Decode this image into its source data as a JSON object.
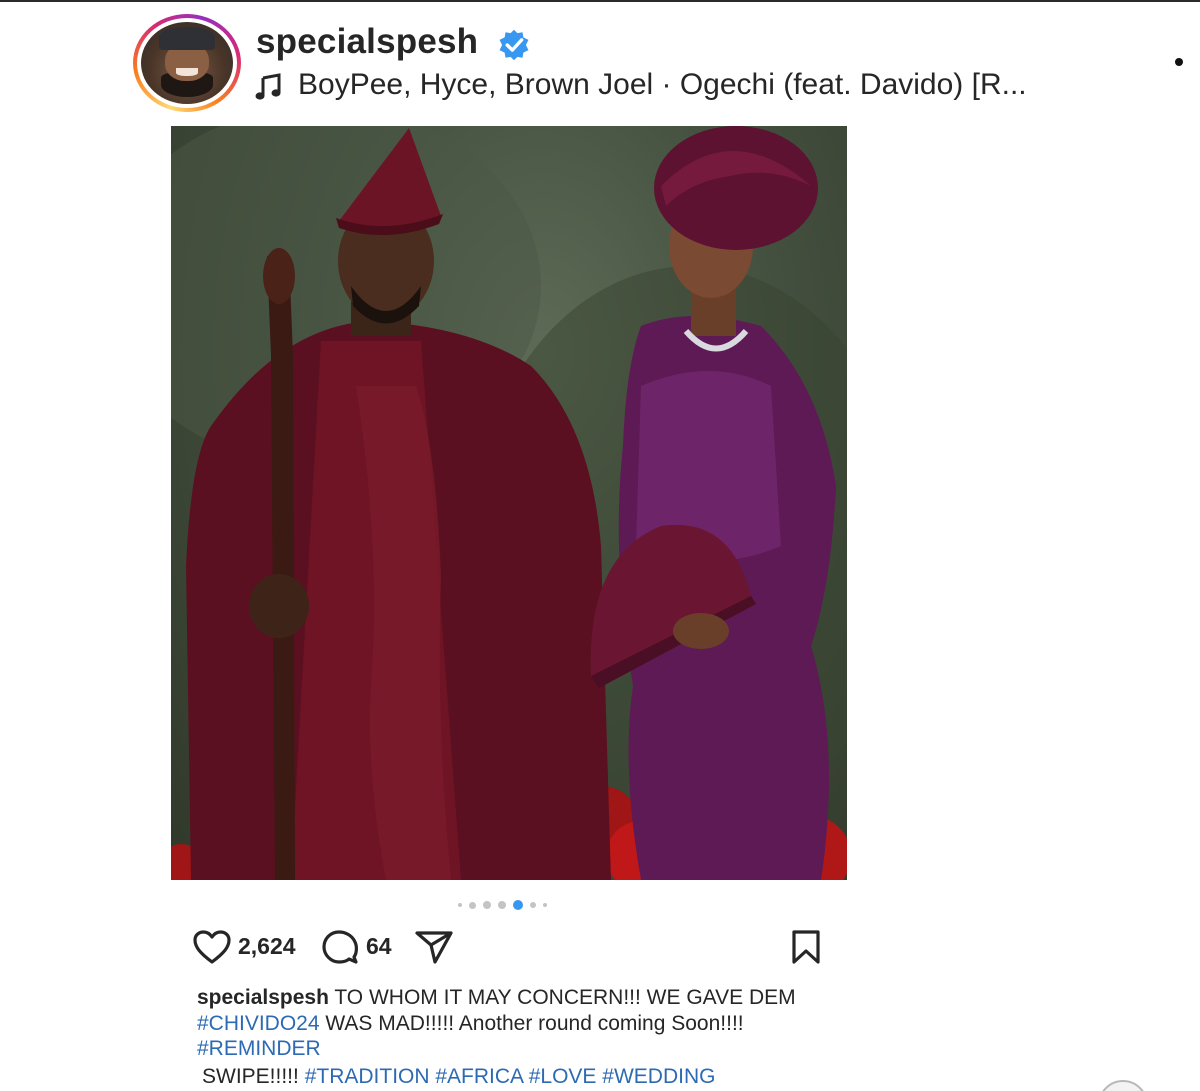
{
  "post": {
    "username": "specialspesh",
    "verified": true,
    "audio_label": "BoyPee, Hyce, Brown Joel · Ogechi (feat. Davido) [R...",
    "likes": "2,624",
    "comments": "64",
    "carousel": {
      "total": 7,
      "active_index": 4
    }
  },
  "caption": {
    "user": "specialspesh",
    "line1_text": " TO WHOM IT MAY CONCERN!!! WE GAVE DEM",
    "line2_tag": "#CHIVIDO24",
    "line2_text": " WAS MAD!!!!! Another round coming Soon!!!!",
    "line3_tag": "#REMINDER",
    "line4_text": "SWIPE!!!!! ",
    "line4_tags": "#TRADITION #AFRICA #LOVE #WEDDING"
  },
  "icons": {
    "verified": "verified-badge-icon",
    "music": "music-note-icon",
    "more": "more-options-icon",
    "like": "heart-icon",
    "comment": "comment-icon",
    "share": "send-icon",
    "save": "bookmark-icon",
    "mute": "speaker-icon"
  },
  "colors": {
    "verified_blue": "#3897f0",
    "hashtag_blue": "#2c6ab4",
    "dot_active": "#3897f0",
    "dot_inactive": "#c4c4c4"
  }
}
